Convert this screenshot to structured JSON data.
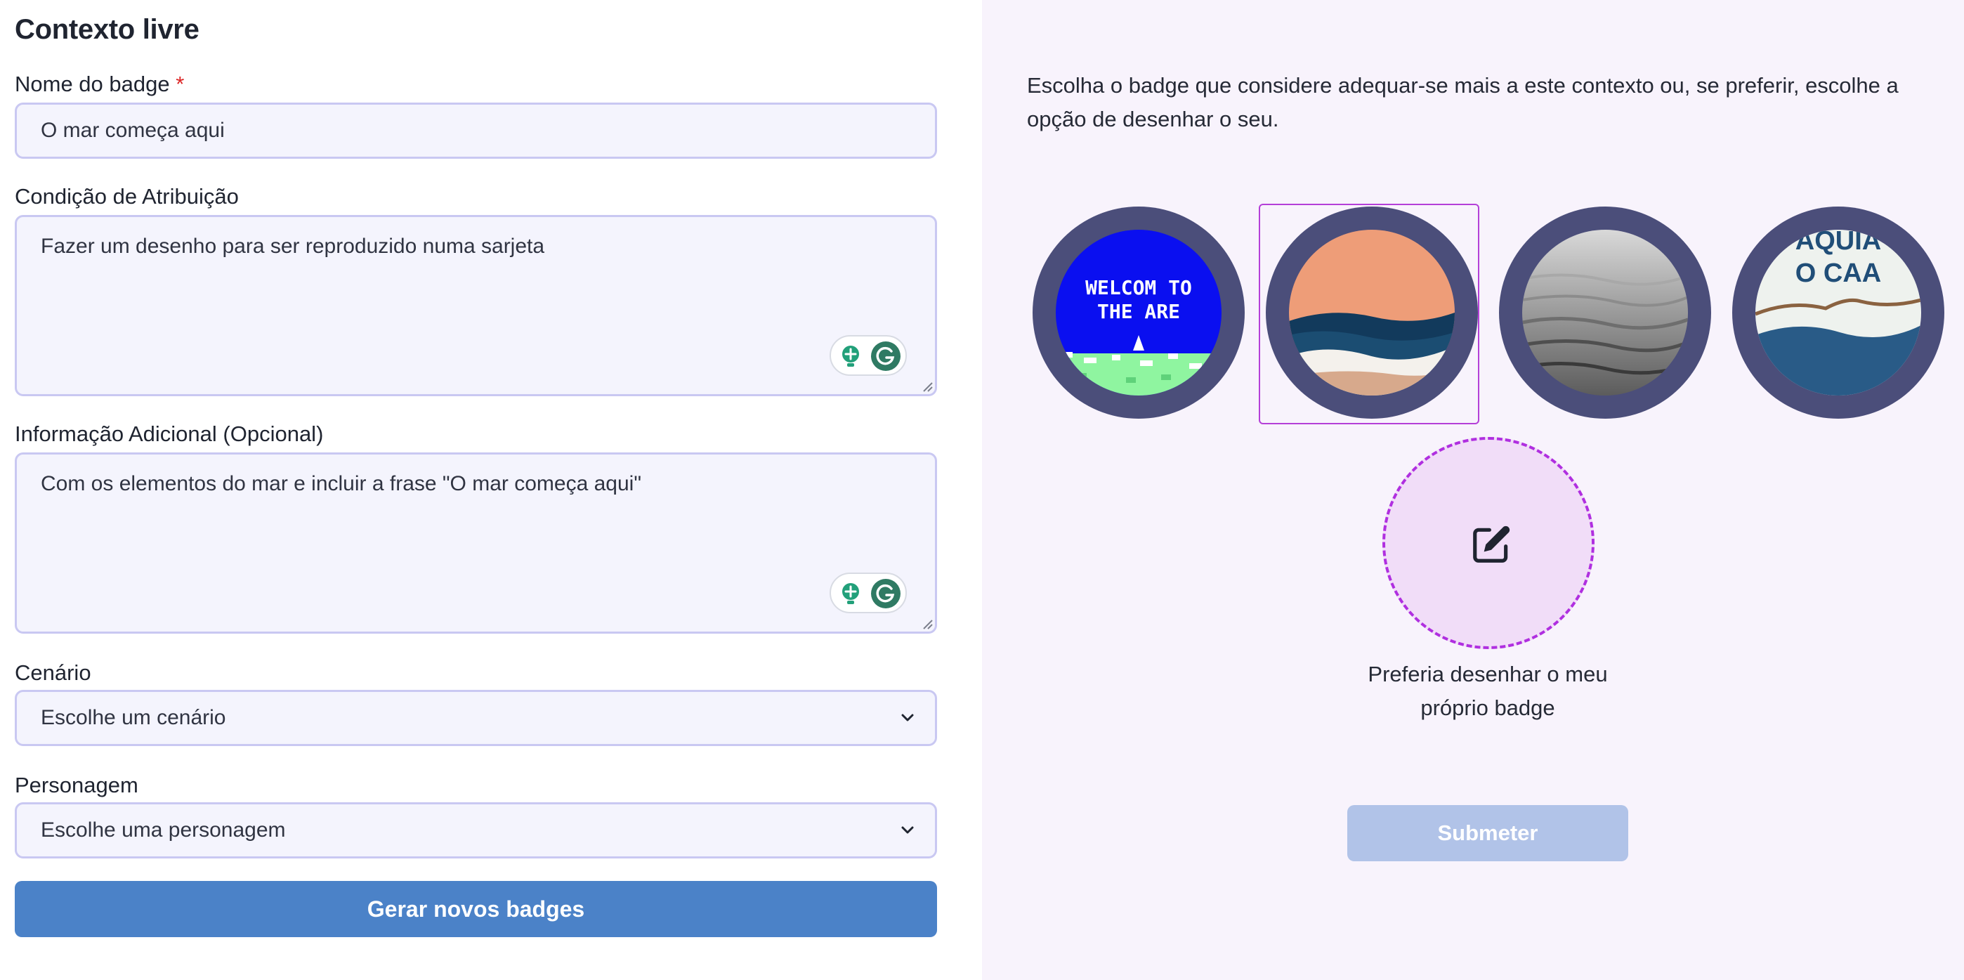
{
  "form": {
    "title": "Contexto livre",
    "badge_name": {
      "label": "Nome do badge",
      "required_mark": "*",
      "value": "O mar começa aqui"
    },
    "condition": {
      "label": "Condição de Atribuição",
      "value": "Fazer um desenho para ser reproduzido numa sarjeta"
    },
    "additional_info": {
      "label": "Informação Adicional (Opcional)",
      "value": "Com os elementos do mar e incluir a frase \"O mar começa aqui\""
    },
    "scenario": {
      "label": "Cenário",
      "selected": "Escolhe um cenário"
    },
    "character": {
      "label": "Personagem",
      "selected": "Escolhe uma personagem"
    },
    "generate_button": "Gerar novos badges"
  },
  "selection": {
    "intro_text": "Escolha o badge que considere adequar-se mais a este contexto ou, se preferir, escolhe a opção de desenhar o seu.",
    "badges": [
      {
        "text_line1": "WELCOM TO",
        "text_line2": "THE ARE",
        "selected": false
      },
      {
        "selected": true
      },
      {
        "selected": false
      },
      {
        "text_line1": "AQUIA",
        "text_line2": "O CAA",
        "selected": false
      }
    ],
    "draw_own_label": "Preferia desenhar o meu próprio badge",
    "submit_button": "Submeter"
  },
  "colors": {
    "primary_button": "#4b82c8",
    "submit_disabled": "#b1c3e8",
    "badge_ring": "#4b4e7a",
    "selection_border": "#b43fd8",
    "right_panel_bg": "#f8f3fc",
    "required": "#dc2626"
  }
}
